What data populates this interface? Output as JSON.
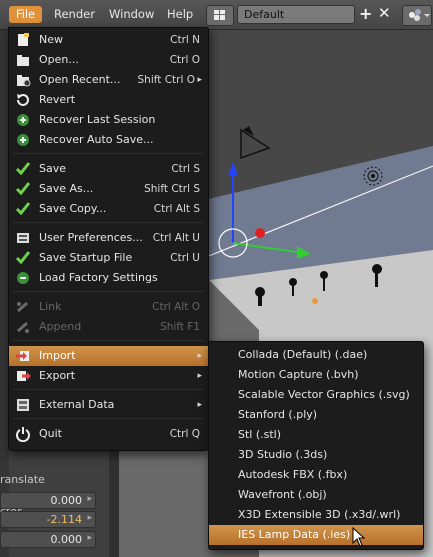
{
  "header": {
    "menus": [
      "File",
      "Render",
      "Window",
      "Help"
    ],
    "layout_name": "Default",
    "add_glyph": "+",
    "close_glyph": "✕"
  },
  "left_panel": {
    "translate_label": "ranslate",
    "vector_label": "ctor",
    "values": [
      "0.000",
      "-2.114",
      "0.000"
    ]
  },
  "file_menu": {
    "items": [
      {
        "label": "New",
        "shortcut": "Ctrl N",
        "icon": "new-file-icon"
      },
      {
        "label": "Open...",
        "shortcut": "Ctrl O",
        "icon": "open-folder-icon"
      },
      {
        "label": "Open Recent...",
        "shortcut": "Shift Ctrl O",
        "icon": "open-recent-icon",
        "submenu": true
      },
      {
        "label": "Revert",
        "shortcut": "",
        "icon": "revert-icon"
      },
      {
        "label": "Recover Last Session",
        "shortcut": "",
        "icon": "recover-icon"
      },
      {
        "label": "Recover Auto Save...",
        "shortcut": "",
        "icon": "recover-autosave-icon"
      },
      {
        "label": "Save",
        "shortcut": "Ctrl S",
        "icon": "save-icon"
      },
      {
        "label": "Save As...",
        "shortcut": "Shift Ctrl S",
        "icon": "save-as-icon"
      },
      {
        "label": "Save Copy...",
        "shortcut": "Ctrl Alt S",
        "icon": "save-copy-icon"
      },
      {
        "label": "User Preferences...",
        "shortcut": "Ctrl Alt U",
        "icon": "preferences-icon"
      },
      {
        "label": "Save Startup File",
        "shortcut": "Ctrl U",
        "icon": "save-startup-icon"
      },
      {
        "label": "Load Factory Settings",
        "shortcut": "",
        "icon": "factory-settings-icon"
      },
      {
        "label": "Link",
        "shortcut": "Ctrl Alt O",
        "icon": "link-icon",
        "disabled": true
      },
      {
        "label": "Append",
        "shortcut": "Shift F1",
        "icon": "append-icon",
        "disabled": true
      },
      {
        "label": "Import",
        "shortcut": "",
        "icon": "import-icon",
        "submenu": true,
        "active": true
      },
      {
        "label": "Export",
        "shortcut": "",
        "icon": "export-icon",
        "submenu": true
      },
      {
        "label": "External Data",
        "shortcut": "",
        "icon": "external-data-icon",
        "submenu": true
      },
      {
        "label": "Quit",
        "shortcut": "Ctrl Q",
        "icon": "quit-icon"
      }
    ]
  },
  "import_submenu": {
    "items": [
      "Collada (Default) (.dae)",
      "Motion Capture (.bvh)",
      "Scalable Vector Graphics (.svg)",
      "Stanford (.ply)",
      "Stl (.stl)",
      "3D Studio (.3ds)",
      "Autodesk FBX (.fbx)",
      "Wavefront (.obj)",
      "X3D Extensible 3D (.x3d/.wrl)",
      "IES Lamp Data (.ies)"
    ],
    "highlighted": "IES Lamp Data (.ies)"
  },
  "colors": {
    "accent": "#e0923a",
    "menu_bg": "#1c1c1c",
    "highlight": "#c58038"
  }
}
